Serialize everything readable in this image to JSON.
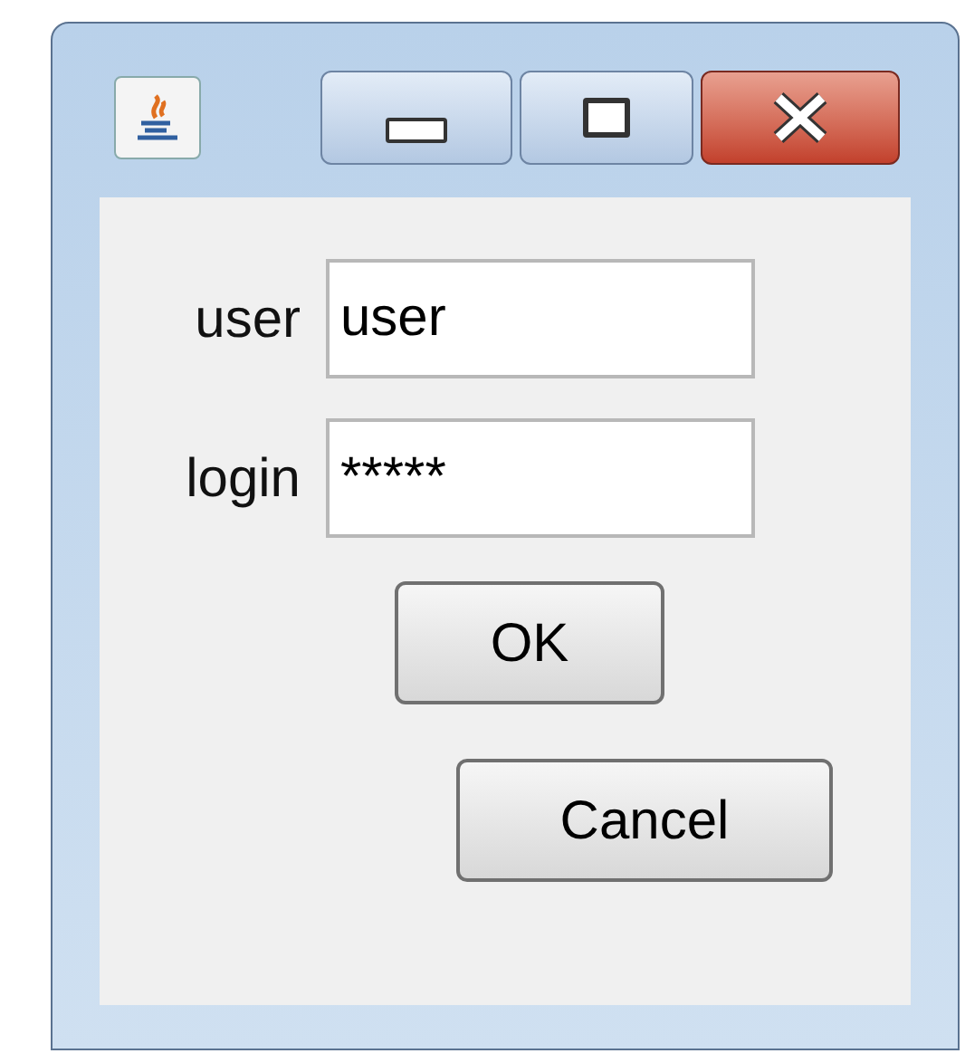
{
  "form": {
    "fields": [
      {
        "label": "user",
        "value": "user"
      },
      {
        "label": "login",
        "value": "*****"
      }
    ]
  },
  "buttons": [
    {
      "label": "OK"
    },
    {
      "label": "Cancel"
    }
  ]
}
